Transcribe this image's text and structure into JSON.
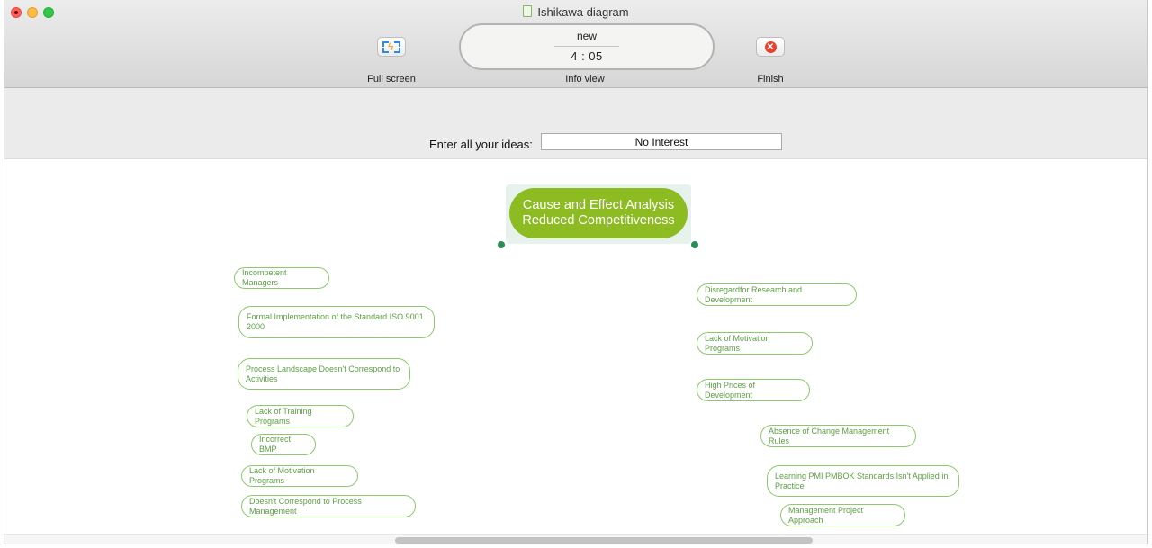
{
  "window": {
    "title": "Ishikawa diagram"
  },
  "toolbar": {
    "full_screen_label": "Full screen",
    "info_view_label": "Info view",
    "finish_label": "Finish",
    "info_status": "new",
    "info_timer": "4 : 05"
  },
  "entry": {
    "label": "Enter all your ideas:",
    "value": "No Interest"
  },
  "root": {
    "line1": "Cause and Effect Analysis",
    "line2": "Reduced Competitiveness"
  },
  "left_ideas": [
    "Incompetent Managers",
    "Formal Implementation of the Standard ISO 9001 2000",
    "Process Landscape Doesn't Correspond to Activities",
    "Lack of Training Programs",
    "Incorrect BMP",
    "Lack of Motivation Programs",
    "Doesn't Correspond to Process Management"
  ],
  "right_ideas": [
    "Disregardfor Research and Development",
    "Lack of Motivation Programs",
    "High Prices of Development",
    "Absence of Change Management Rules",
    "Learning PMI PMBOK Standards Isn't Applied in Practice",
    "Management Project Approach"
  ],
  "icons": {
    "full_screen": "full-screen-icon",
    "finish": "close-circle-icon",
    "document": "document-icon"
  },
  "colors": {
    "root_fill": "#8cbc22",
    "idea_border": "#8cc96a",
    "idea_text": "#5b9e44",
    "connector": "#2e8b57"
  }
}
